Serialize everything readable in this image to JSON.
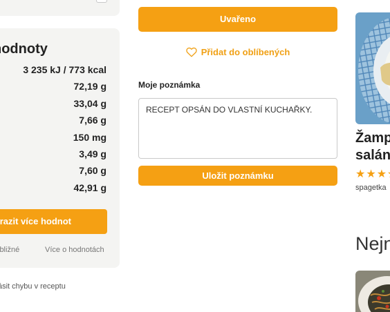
{
  "nutrition": {
    "title": "hodnoty",
    "rows": [
      "3 235 kJ / 773 kcal",
      "72,19 g",
      "33,04 g",
      "7,66 g",
      "150 mg",
      "3,49 g",
      "7,60 g",
      "42,91 g"
    ],
    "more_button": "razit více hodnot",
    "approx_note": "ibližné",
    "about_values_link": "Více o hodnotách"
  },
  "report_error_link": "ásit chybu v receptu",
  "recipe_actions": {
    "cooked_button": "Uvařeno",
    "favorite_link": "Přidat do oblíbených",
    "note_label": "Moje poznámka",
    "note_value": "RECEPT OPSÁN DO VLASTNÍ KUCHAŘKY.",
    "save_note_button": "Uložit poznámku"
  },
  "sidebar": {
    "card_title_line1": "Žamp",
    "card_title_line2": "salán",
    "card_stars": "★★★★",
    "card_tag": "spagetka",
    "section_heading": "Nejn"
  },
  "colors": {
    "accent": "#f5a013",
    "panel_bg": "#f4f4f2"
  }
}
